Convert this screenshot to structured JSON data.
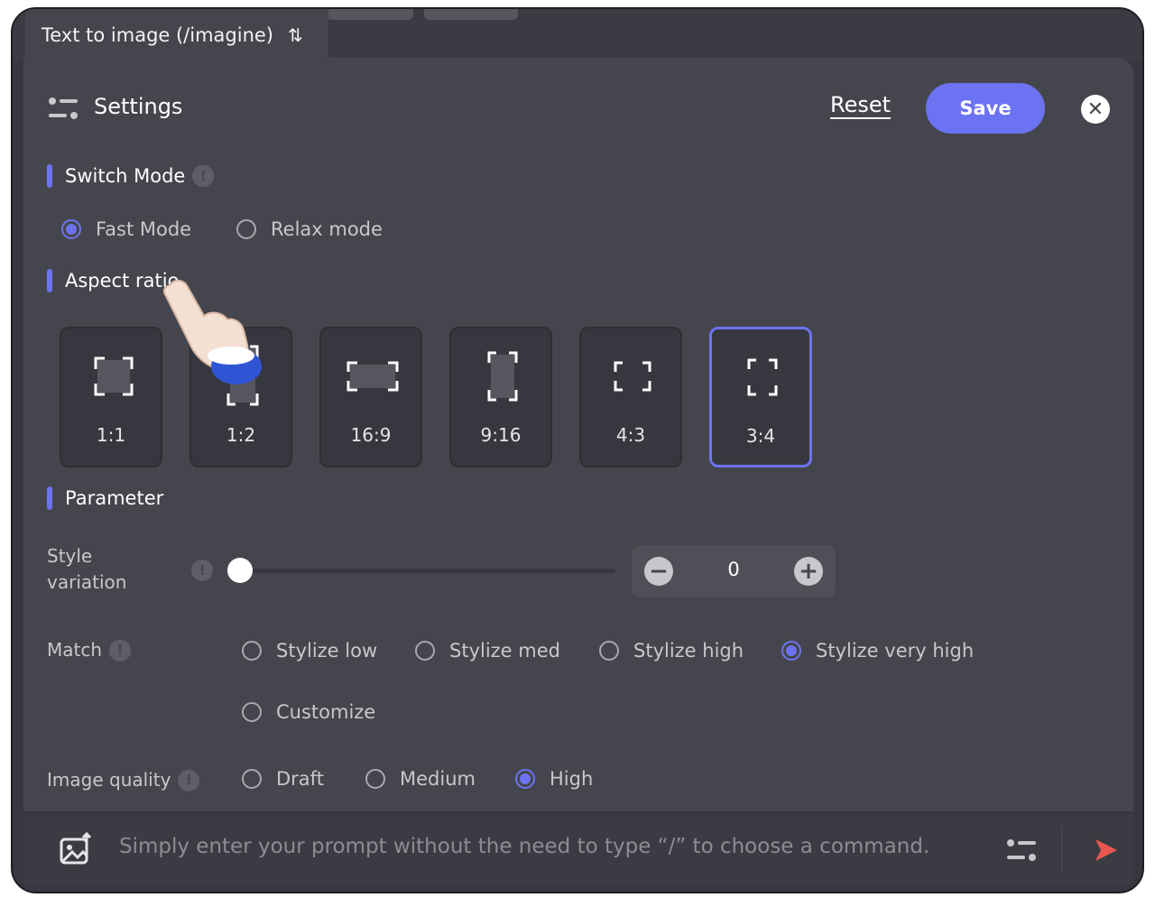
{
  "tab": {
    "label": "Text to image (/imagine)",
    "sort_icon": "⇅"
  },
  "header": {
    "title": "Settings",
    "reset_label": "Reset",
    "save_label": "Save",
    "close_glyph": "✕"
  },
  "switch_mode": {
    "heading": "Switch Mode",
    "info_glyph": "!",
    "options": [
      {
        "label": "Fast Mode",
        "selected": true
      },
      {
        "label": "Relax mode",
        "selected": false
      }
    ]
  },
  "aspect_ratio": {
    "heading": "Aspect ratio",
    "options": [
      {
        "label": "1:1",
        "selected": false
      },
      {
        "label": "1:2",
        "selected": false
      },
      {
        "label": "16:9",
        "selected": false
      },
      {
        "label": "9:16",
        "selected": false
      },
      {
        "label": "4:3",
        "selected": false
      },
      {
        "label": "3:4",
        "selected": true
      }
    ]
  },
  "parameter": {
    "heading": "Parameter",
    "style_variation": {
      "label_line1": "Style",
      "label_line2": "variation",
      "value": "0",
      "minus": "−",
      "plus": "+"
    },
    "match": {
      "label": "Match",
      "options": [
        {
          "label": "Stylize low",
          "selected": false
        },
        {
          "label": "Stylize med",
          "selected": false
        },
        {
          "label": "Stylize high",
          "selected": false
        },
        {
          "label": "Stylize very high",
          "selected": true
        },
        {
          "label": "Customize",
          "selected": false
        }
      ]
    },
    "image_quality": {
      "label": "Image quality",
      "options": [
        {
          "label": "Draft",
          "selected": false
        },
        {
          "label": "Medium",
          "selected": false
        },
        {
          "label": "High",
          "selected": true
        }
      ]
    }
  },
  "prompt_bar": {
    "placeholder": "Simply enter your prompt without the need to type “/” to choose a command."
  },
  "colors": {
    "accent": "#6c73f2",
    "panel": "#45464d",
    "send": "#e8584f"
  }
}
